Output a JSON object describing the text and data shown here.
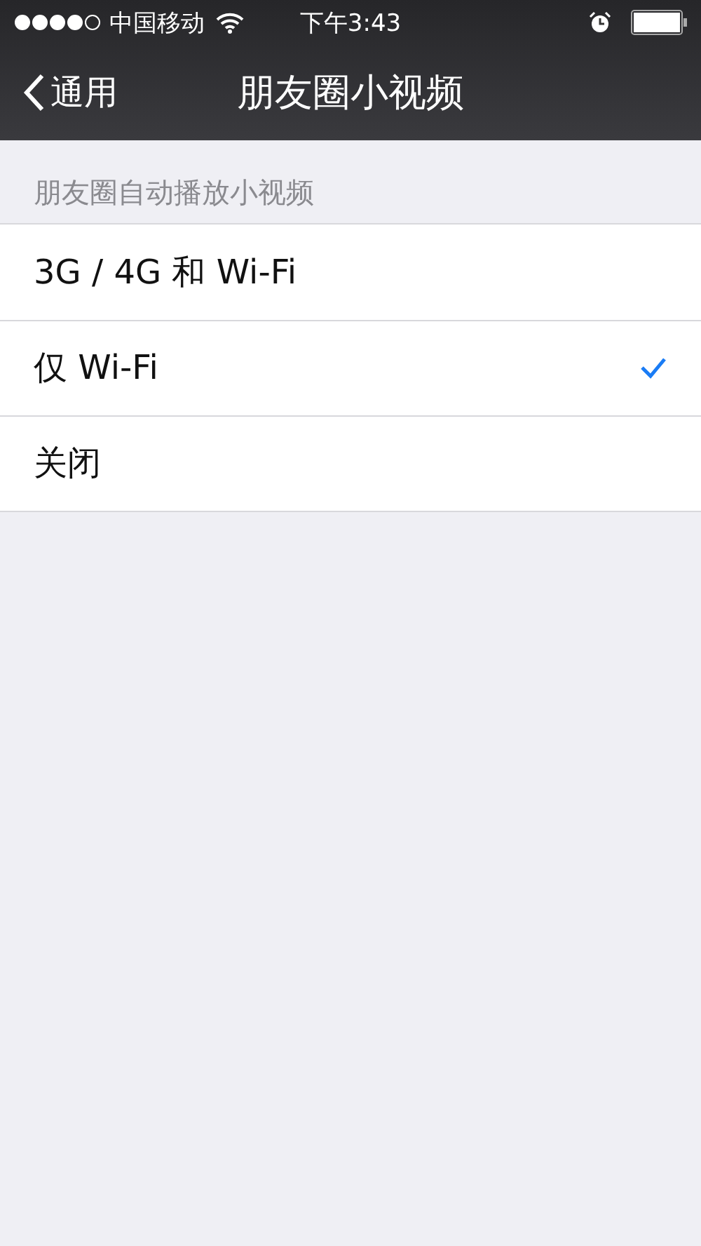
{
  "status_bar": {
    "carrier": "中国移动",
    "time": "下午3:43"
  },
  "nav_bar": {
    "back_label": "通用",
    "title": "朋友圈小视频"
  },
  "section": {
    "header": "朋友圈自动播放小视频",
    "options": [
      {
        "label": "3G / 4G 和 Wi-Fi",
        "selected": false
      },
      {
        "label": "仅 Wi-Fi",
        "selected": true
      },
      {
        "label": "关闭",
        "selected": false
      }
    ]
  }
}
